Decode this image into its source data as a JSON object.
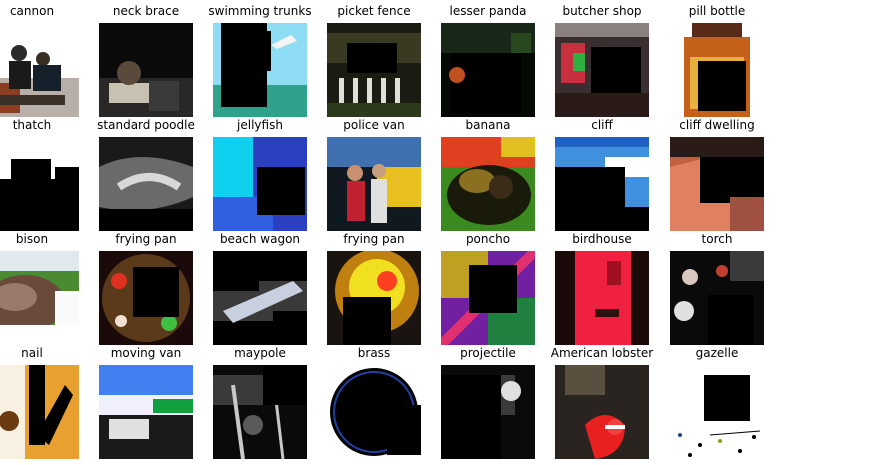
{
  "grid": {
    "rows": [
      [
        {
          "label": "cannon",
          "icon": "photo-people-white-background"
        },
        {
          "label": "neck brace",
          "icon": "photo-dark-room"
        },
        {
          "label": "swimming trunks",
          "icon": "photo-pool-blue"
        },
        {
          "label": "picket fence",
          "icon": "photo-fence-trees"
        },
        {
          "label": "lesser panda",
          "icon": "photo-dark-foliage"
        },
        {
          "label": "butcher shop",
          "icon": "photo-market-stall"
        },
        {
          "label": "pill bottle",
          "icon": "photo-orange-bottle"
        }
      ],
      [
        {
          "label": "thatch",
          "icon": "photo-white-sky"
        },
        {
          "label": "standard poodle",
          "icon": "photo-gray-poodle"
        },
        {
          "label": "jellyfish",
          "icon": "photo-cyan-water"
        },
        {
          "label": "police van",
          "icon": "photo-people-yellow-van"
        },
        {
          "label": "banana",
          "icon": "photo-colorful-fruit"
        },
        {
          "label": "cliff",
          "icon": "photo-blue-sky-cliff"
        },
        {
          "label": "cliff dwelling",
          "icon": "photo-rocky-cliff"
        }
      ],
      [
        {
          "label": "bison",
          "icon": "photo-brown-bison"
        },
        {
          "label": "frying pan",
          "icon": "photo-food-pan"
        },
        {
          "label": "beach wagon",
          "icon": "photo-car-dark"
        },
        {
          "label": "frying pan",
          "icon": "photo-yellow-pan"
        },
        {
          "label": "poncho",
          "icon": "photo-colorful-pattern"
        },
        {
          "label": "birdhouse",
          "icon": "photo-red-pole"
        },
        {
          "label": "torch",
          "icon": "photo-dark-people"
        }
      ],
      [
        {
          "label": "nail",
          "icon": "photo-yellow-wood"
        },
        {
          "label": "moving van",
          "icon": "photo-truck-sky"
        },
        {
          "label": "maypole",
          "icon": "photo-dark-crowd"
        },
        {
          "label": "brass",
          "icon": "photo-black-disc"
        },
        {
          "label": "projectile",
          "icon": "photo-dark-object"
        },
        {
          "label": "American lobster",
          "icon": "photo-red-lobster"
        },
        {
          "label": "gazelle",
          "icon": "photo-white-field"
        }
      ]
    ]
  },
  "colors": {
    "background": "#ffffff",
    "label": "#000000",
    "occlusion": "#000000"
  }
}
